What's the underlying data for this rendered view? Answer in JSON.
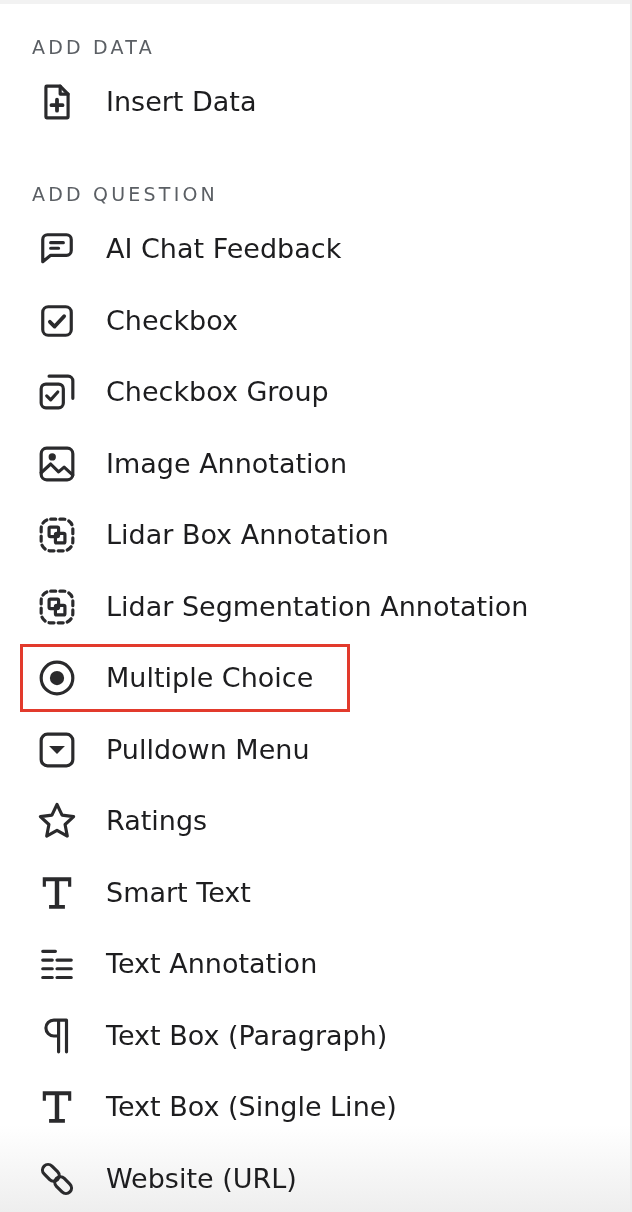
{
  "sections": [
    {
      "heading": "ADD DATA",
      "items": [
        {
          "label": "Insert Data",
          "highlighted": false
        }
      ]
    },
    {
      "heading": "ADD QUESTION",
      "items": [
        {
          "label": "AI Chat Feedback",
          "highlighted": false
        },
        {
          "label": "Checkbox",
          "highlighted": false
        },
        {
          "label": "Checkbox Group",
          "highlighted": false
        },
        {
          "label": "Image Annotation",
          "highlighted": false
        },
        {
          "label": "Lidar Box Annotation",
          "highlighted": false
        },
        {
          "label": "Lidar Segmentation Annotation",
          "highlighted": false
        },
        {
          "label": "Multiple Choice",
          "highlighted": true
        },
        {
          "label": "Pulldown Menu",
          "highlighted": false
        },
        {
          "label": "Ratings",
          "highlighted": false
        },
        {
          "label": "Smart Text",
          "highlighted": false
        },
        {
          "label": "Text Annotation",
          "highlighted": false
        },
        {
          "label": "Text Box (Paragraph)",
          "highlighted": false
        },
        {
          "label": "Text Box (Single Line)",
          "highlighted": false
        },
        {
          "label": "Website (URL)",
          "highlighted": false
        }
      ]
    }
  ]
}
